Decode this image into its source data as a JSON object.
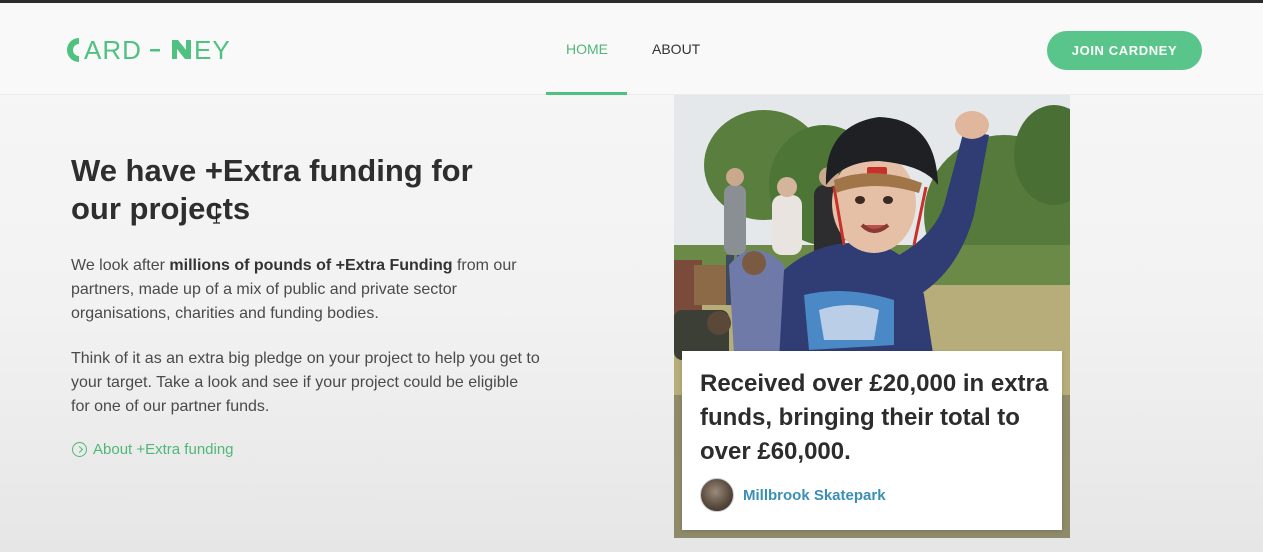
{
  "header": {
    "logo_text": "CARD-NEY",
    "nav": [
      {
        "label": "HOME",
        "active": true
      },
      {
        "label": "ABOUT",
        "active": false
      }
    ],
    "cta_label": "JOIN CARDNEY"
  },
  "hero": {
    "title": "We have +Extra funding for our projects",
    "para1_pre": "We look after ",
    "para1_bold": "millions of pounds of +Extra Funding",
    "para1_post": " from our partners, made up of a mix of public and private sector organisations, charities and funding bodies.",
    "para2": "Think of it as an extra big pledge on your project to help you get to your target. Take a look and see if your project could be eligible for one of our partner funds.",
    "link_label": "About +Extra funding"
  },
  "case_study": {
    "quote": "Received over £20,000 in extra funds, bringing their total to over £60,000.",
    "source": "Millbrook Skatepark"
  },
  "colors": {
    "brand_green": "#4fc181",
    "link_blue": "#3b8fb6",
    "text_dark": "#2e2e2e"
  },
  "icons": {
    "more_link": "circle-arrow-right-icon",
    "cursor": "text-cursor-icon"
  }
}
